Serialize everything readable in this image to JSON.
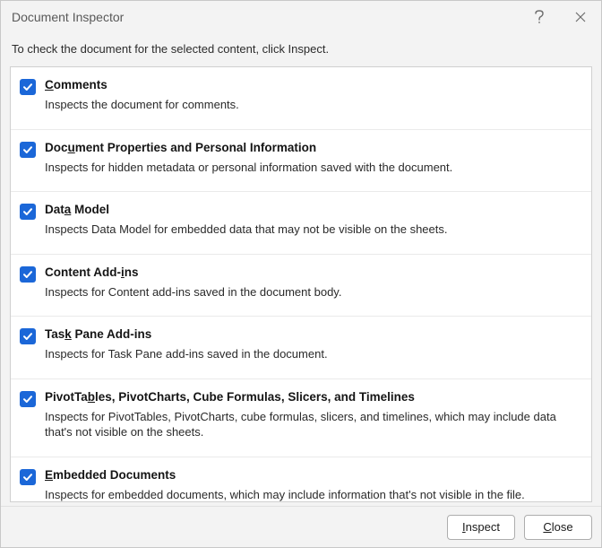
{
  "dialog": {
    "title": "Document Inspector",
    "instruction": "To check the document for the selected content, click Inspect.",
    "help_label": "Help",
    "close_window_label": "Close window"
  },
  "items": [
    {
      "checked": true,
      "title_pre": "",
      "title_accel": "C",
      "title_post": "omments",
      "desc": "Inspects the document for comments."
    },
    {
      "checked": true,
      "title_pre": "Doc",
      "title_accel": "u",
      "title_post": "ment Properties and Personal Information",
      "desc": "Inspects for hidden metadata or personal information saved with the document."
    },
    {
      "checked": true,
      "title_pre": "Dat",
      "title_accel": "a",
      "title_post": " Model",
      "desc": "Inspects Data Model for embedded data that may not be visible on the sheets."
    },
    {
      "checked": true,
      "title_pre": "Content Add-",
      "title_accel": "i",
      "title_post": "ns",
      "desc": "Inspects for Content add-ins saved in the document body."
    },
    {
      "checked": true,
      "title_pre": "Tas",
      "title_accel": "k",
      "title_post": " Pane Add-ins",
      "desc": "Inspects for Task Pane add-ins saved in the document."
    },
    {
      "checked": true,
      "title_pre": "PivotTa",
      "title_accel": "b",
      "title_post": "les, PivotCharts, Cube Formulas, Slicers, and Timelines",
      "desc": "Inspects for PivotTables, PivotCharts, cube formulas, slicers, and timelines, which may include data that's not visible on the sheets."
    },
    {
      "checked": true,
      "title_pre": "",
      "title_accel": "E",
      "title_post": "mbedded Documents",
      "desc": "Inspects for embedded documents, which may include information that's not visible in the file."
    }
  ],
  "buttons": {
    "inspect_pre": "",
    "inspect_accel": "I",
    "inspect_post": "nspect",
    "close_pre": "",
    "close_accel": "C",
    "close_post": "lose"
  }
}
